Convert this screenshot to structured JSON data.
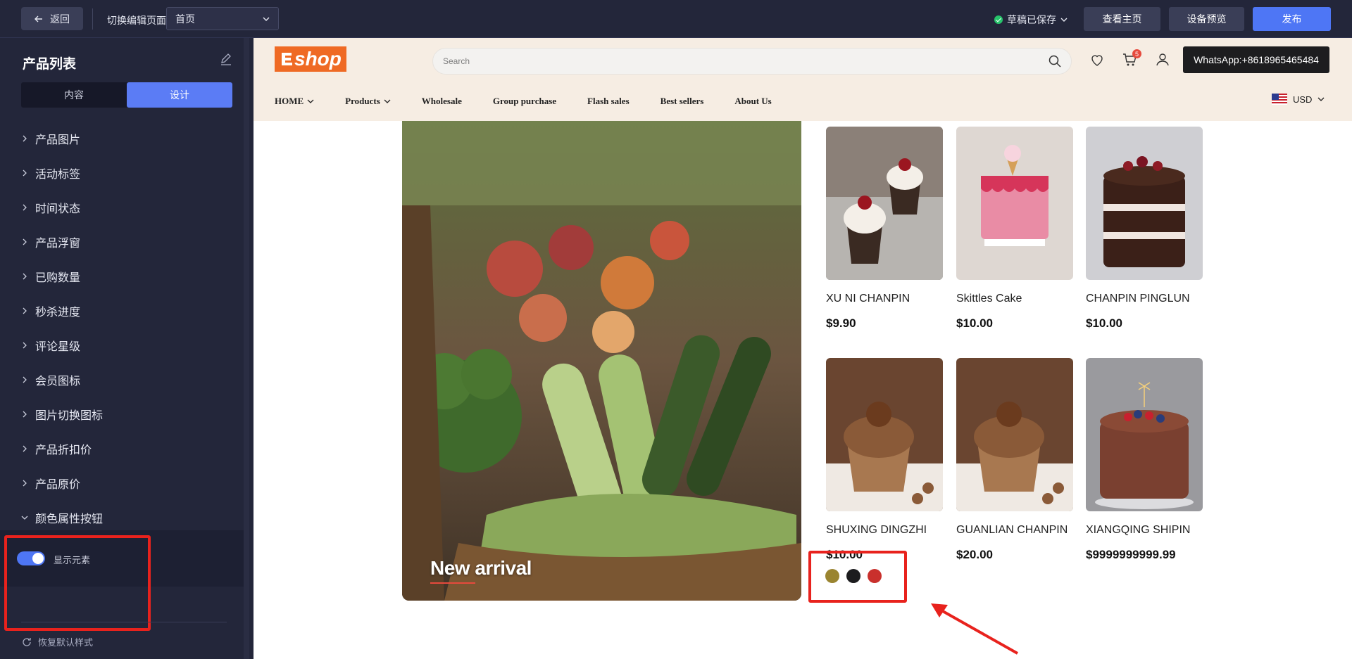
{
  "topbar": {
    "back_label": "返回",
    "switch_label": "切换编辑页面",
    "page_select_value": "首页",
    "draft_status": "草稿已保存",
    "view_home_label": "查看主页",
    "device_preview_label": "设备预览",
    "publish_label": "发布"
  },
  "sidebar": {
    "title": "产品列表",
    "tabs": [
      {
        "label": "内容"
      },
      {
        "label": "设计"
      }
    ],
    "active_tab": "设计",
    "items": [
      {
        "label": "产品图片"
      },
      {
        "label": "活动标签"
      },
      {
        "label": "时间状态"
      },
      {
        "label": "产品浮窗"
      },
      {
        "label": "已购数量"
      },
      {
        "label": "秒杀进度"
      },
      {
        "label": "评论星级"
      },
      {
        "label": "会员图标"
      },
      {
        "label": "图片切换图标"
      },
      {
        "label": "产品折扣价"
      },
      {
        "label": "产品原价"
      },
      {
        "label": "颜色属性按钮"
      }
    ],
    "expanded_item": "颜色属性按钮",
    "toggle_label": "显示元素",
    "toggle_on": true,
    "reset_label": "恢复默认样式"
  },
  "store": {
    "logo_text": "shop",
    "search_placeholder": "Search",
    "cart_count": "5",
    "whatsapp": "WhatsApp:+8618965465484",
    "nav": [
      {
        "label": "HOME",
        "has_dropdown": true
      },
      {
        "label": "Products",
        "has_dropdown": true
      },
      {
        "label": "Wholesale",
        "has_dropdown": false
      },
      {
        "label": "Group purchase",
        "has_dropdown": false
      },
      {
        "label": "Flash sales",
        "has_dropdown": false
      },
      {
        "label": "Best sellers",
        "has_dropdown": false
      },
      {
        "label": "About Us",
        "has_dropdown": false
      }
    ],
    "currency": "USD",
    "banner_text": "New arrival",
    "products": [
      {
        "name": "XU NI CHANPIN",
        "price": "$9.90"
      },
      {
        "name": "Skittles Cake",
        "price": "$10.00"
      },
      {
        "name": "CHANPIN PINGLUN",
        "price": "$10.00"
      },
      {
        "name": "SHUXING DINGZHI",
        "price": "$10.00"
      },
      {
        "name": "GUANLIAN CHANPIN",
        "price": "$20.00"
      },
      {
        "name": "XIANGQING SHIPIN",
        "price": "$9999999999.99"
      }
    ],
    "color_swatches": [
      "#9a8430",
      "#1c1c1e",
      "#c9302c"
    ]
  },
  "colors": {
    "accent": "#4e76f5",
    "highlight": "#e8221d",
    "brand": "#ef6a24"
  }
}
